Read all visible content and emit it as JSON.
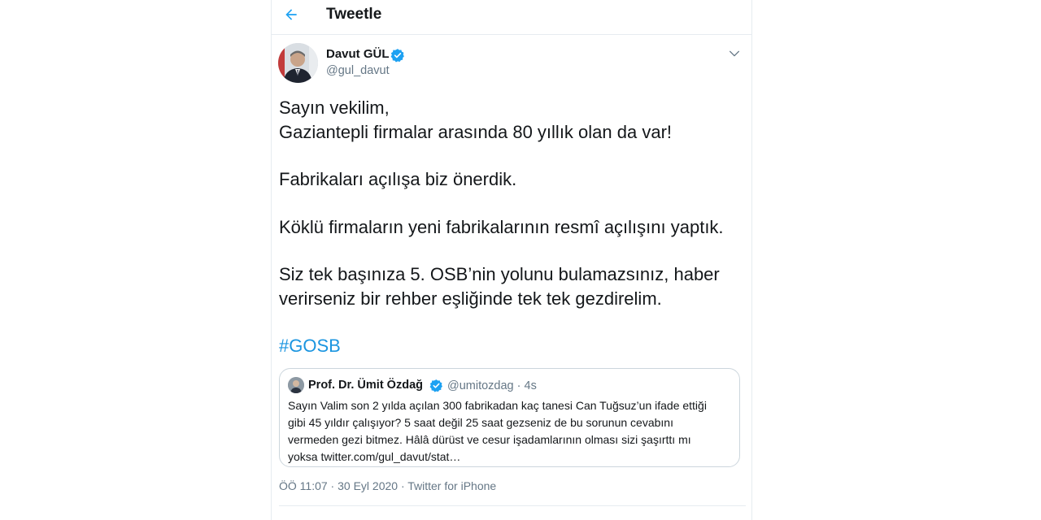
{
  "header": {
    "title": "Tweetle",
    "back_icon": "arrow-left-icon"
  },
  "tweet": {
    "author": {
      "name": "Davut GÜL",
      "handle": "@gul_davut",
      "verified": true
    },
    "menu_icon": "chevron-down-icon",
    "lines": [
      "Sayın vekilim,",
      "Gaziantepli firmalar arasında 80 yıllık olan da var!",
      "",
      "Fabrikaları açılışa biz önerdik.",
      "",
      "Köklü firmaların yeni fabrikalarının resmî açılışını yaptık.",
      "",
      "Siz tek başınıza 5. OSB’nin yolunu bulamazsınız, haber",
      "verirseniz bir rehber eşliğinde tek tek gezdirelim.",
      ""
    ],
    "hashtag": "#GOSB",
    "meta": "ÖÖ 11:07 · 30 Eyl 2020 · Twitter for iPhone"
  },
  "quoted_tweet": {
    "name": "Prof. Dr. Ümit Özdağ",
    "handle_time": "@umitozdag · 4s",
    "verified": true,
    "text_lines": [
      "Sayın Valim son 2 yılda açılan 300 fabrikadan kaç tanesi Can Tuğsuz’un ifade ettiği",
      "gibi 45 yıldır çalışıyor? 5 saat değil 25 saat gezseniz de bu sorunun cevabını",
      "vermeden gezi bitmez. Hâlâ dürüst ve cesur işadamlarının olması sizi şaşırttı mı",
      "yoksa twitter.com/gul_davut/stat…"
    ]
  },
  "colors": {
    "accent": "#1b95e0",
    "text": "#14171a",
    "secondary": "#657786",
    "border": "#e6ecf0"
  }
}
